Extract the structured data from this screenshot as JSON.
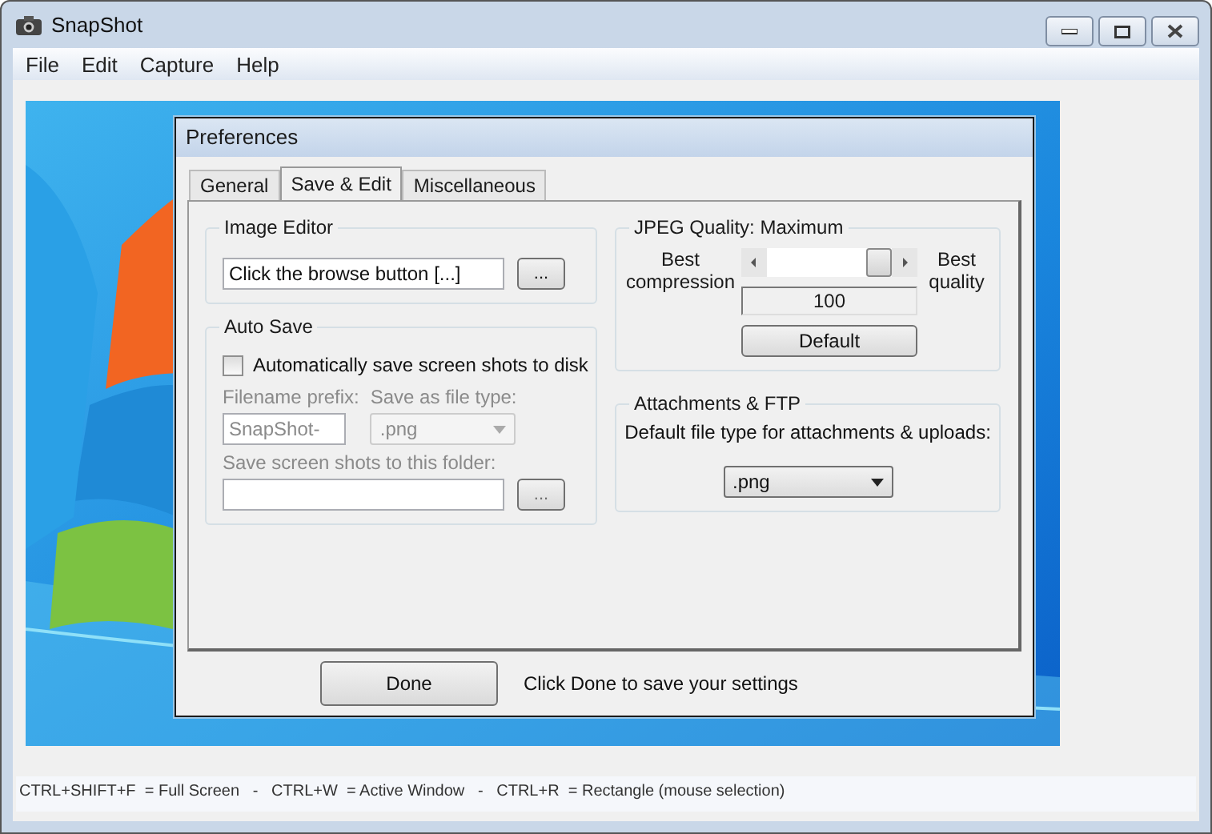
{
  "window": {
    "title": "SnapShot"
  },
  "menu": [
    "File",
    "Edit",
    "Capture",
    "Help"
  ],
  "dialog": {
    "title": "Preferences",
    "tabs": [
      {
        "label": "General",
        "selected": false
      },
      {
        "label": "Save & Edit",
        "selected": true
      },
      {
        "label": "Miscellaneous",
        "selected": false
      }
    ],
    "image_editor": {
      "title": "Image Editor",
      "value": "Click the browse button [...]",
      "browse": "..."
    },
    "auto_save": {
      "title": "Auto Save",
      "checkbox": {
        "label": "Automatically save screen shots to disk",
        "checked": false
      },
      "disabled": true,
      "prefix_label": "Filename prefix:",
      "prefix_value": "SnapShot-",
      "type_label": "Save as file type:",
      "type_value": ".png",
      "folder_label": "Save screen shots to this folder:",
      "browse": "..."
    },
    "jpeg": {
      "title": "JPEG Quality: Maximum",
      "left_label": "Best compression",
      "right_label": "Best quality",
      "level": 1,
      "value": "100",
      "default_button": "Default"
    },
    "attachments": {
      "title": "Attachments & FTP",
      "label": "Default file type for attachments & uploads:",
      "value": ".png"
    },
    "done_button": "Done",
    "done_hint": "Click Done to save your settings"
  },
  "status_bar": "CTRL+SHIFT+F  = Full Screen   -   CTRL+W  = Active Window   -   CTRL+R  = Rectangle (mouse selection)"
}
